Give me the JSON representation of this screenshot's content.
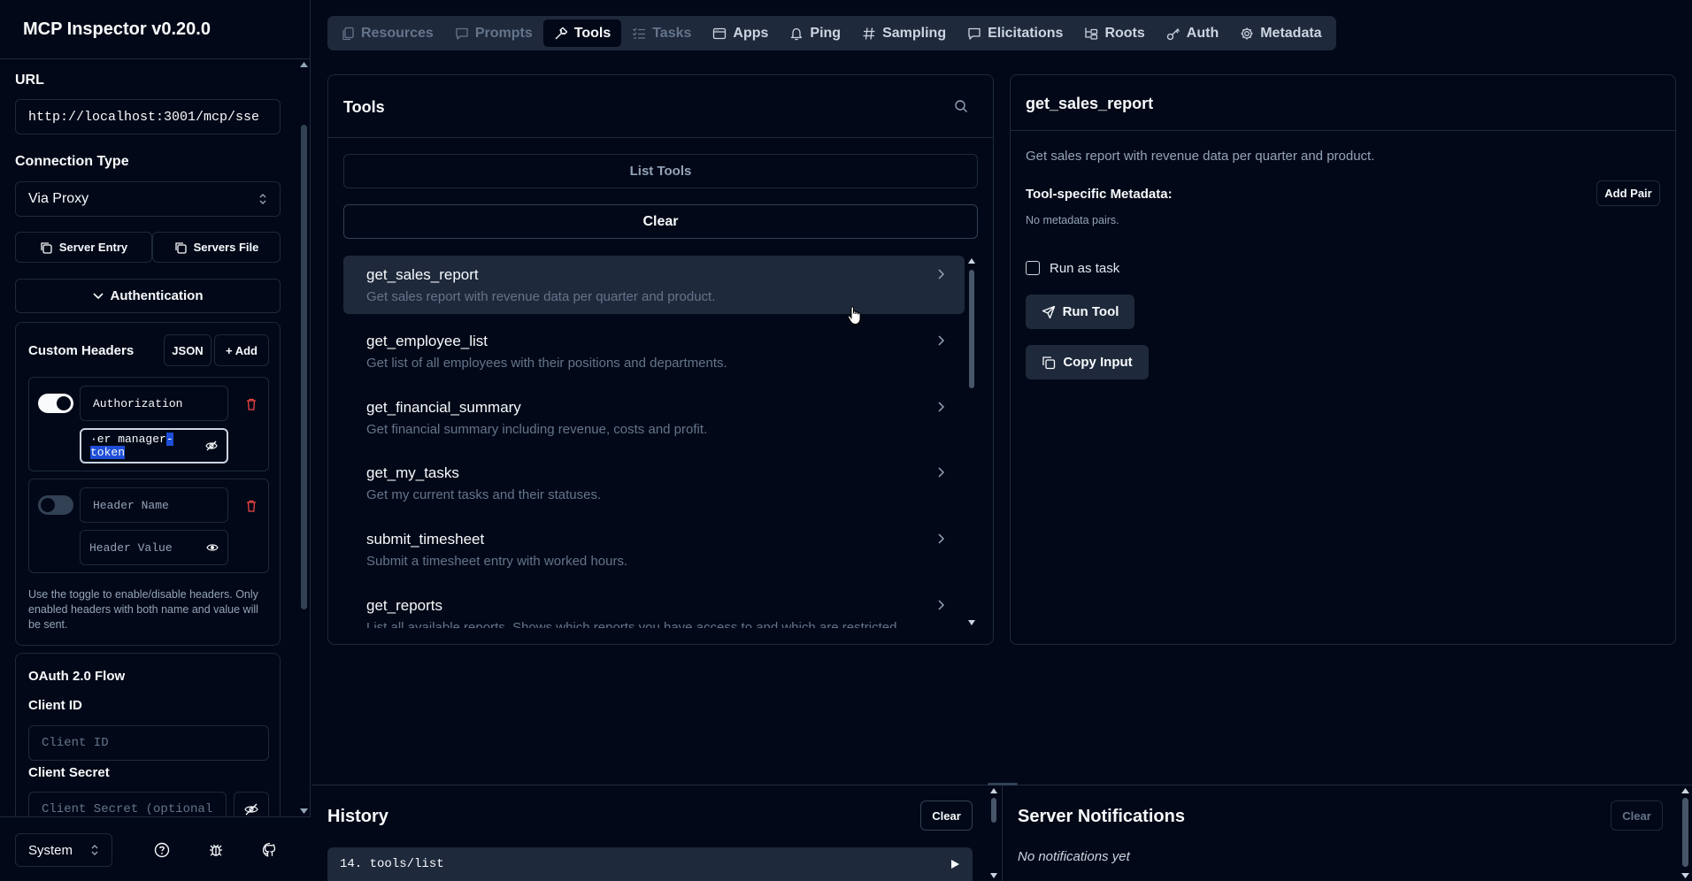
{
  "app": {
    "title": "MCP Inspector v0.20.0"
  },
  "sidebar": {
    "url_label": "URL",
    "url_value": "http://localhost:3001/mcp/sse",
    "connection_type_label": "Connection Type",
    "connection_type_value": "Via Proxy",
    "server_entry_label": "Server Entry",
    "servers_file_label": "Servers File",
    "authentication_label": "Authentication",
    "custom_headers_label": "Custom Headers",
    "json_label": "JSON",
    "add_label": "+ Add",
    "headers": [
      {
        "enabled": true,
        "name": "Authorization",
        "value_prefix": "·er manager",
        "value_selected": "-token"
      },
      {
        "enabled": false,
        "name_placeholder": "Header Name",
        "value_placeholder": "Header Value"
      }
    ],
    "headers_help": "Use the toggle to enable/disable headers. Only enabled headers with both name and value will be sent.",
    "oauth_title": "OAuth 2.0 Flow",
    "client_id_label": "Client ID",
    "client_id_placeholder": "Client ID",
    "client_secret_label": "Client Secret",
    "client_secret_placeholder": "Client Secret (optional",
    "theme_value": "System"
  },
  "tabs": [
    {
      "label": "Resources",
      "icon": "file-icon",
      "state": "disabled"
    },
    {
      "label": "Prompts",
      "icon": "message-icon",
      "state": "disabled"
    },
    {
      "label": "Tools",
      "icon": "hammer-icon",
      "state": "active"
    },
    {
      "label": "Tasks",
      "icon": "list-icon",
      "state": "disabled"
    },
    {
      "label": "Apps",
      "icon": "app-window-icon",
      "state": "normal"
    },
    {
      "label": "Ping",
      "icon": "bell-icon",
      "state": "normal"
    },
    {
      "label": "Sampling",
      "icon": "hash-icon",
      "state": "normal"
    },
    {
      "label": "Elicitations",
      "icon": "message-icon",
      "state": "normal"
    },
    {
      "label": "Roots",
      "icon": "folder-tree-icon",
      "state": "normal"
    },
    {
      "label": "Auth",
      "icon": "key-icon",
      "state": "normal"
    },
    {
      "label": "Metadata",
      "icon": "gear-icon",
      "state": "normal"
    }
  ],
  "tools_panel": {
    "title": "Tools",
    "list_tools_label": "List Tools",
    "clear_label": "Clear",
    "items": [
      {
        "name": "get_sales_report",
        "description": "Get sales report with revenue data per quarter and product."
      },
      {
        "name": "get_employee_list",
        "description": "Get list of all employees with their positions and departments."
      },
      {
        "name": "get_financial_summary",
        "description": "Get financial summary including revenue, costs and profit."
      },
      {
        "name": "get_my_tasks",
        "description": "Get my current tasks and their statuses."
      },
      {
        "name": "submit_timesheet",
        "description": "Submit a timesheet entry with worked hours."
      },
      {
        "name": "get_reports",
        "description": "List all available reports. Shows which reports you have access to and which are restricted."
      }
    ]
  },
  "detail_panel": {
    "title": "get_sales_report",
    "description": "Get sales report with revenue data per quarter and product.",
    "metadata_label": "Tool-specific Metadata:",
    "add_pair_label": "Add Pair",
    "no_metadata": "No metadata pairs.",
    "run_as_task_label": "Run as task",
    "run_tool_label": "Run Tool",
    "copy_input_label": "Copy Input"
  },
  "history": {
    "title": "History",
    "clear_label": "Clear",
    "entries": [
      {
        "label": "14. tools/list"
      }
    ]
  },
  "notifications": {
    "title": "Server Notifications",
    "clear_label": "Clear",
    "empty_text": "No notifications yet"
  },
  "colors": {
    "background": "#020817",
    "border": "#1e293b",
    "selection": "#1d4ed8",
    "danger": "#ef4444"
  }
}
